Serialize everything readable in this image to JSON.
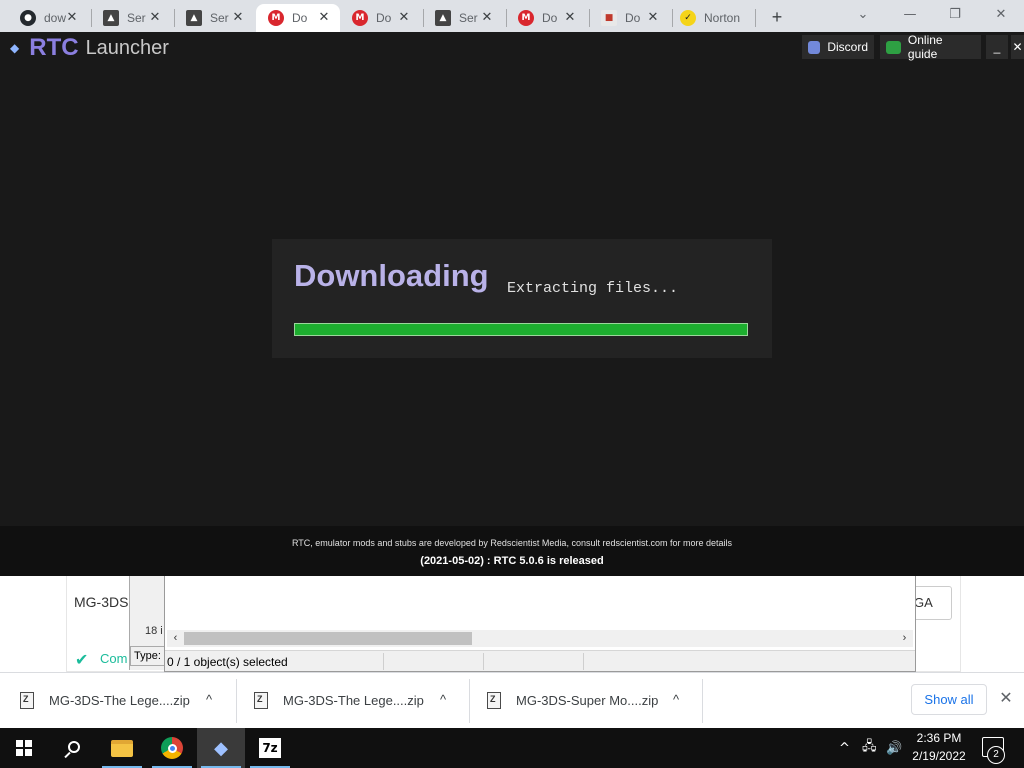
{
  "browser": {
    "tabs": [
      {
        "title": "dow",
        "icon": "github-icon",
        "active": false
      },
      {
        "title": "Ser",
        "icon": "inkscape-icon",
        "active": false
      },
      {
        "title": "Ser",
        "icon": "inkscape-icon",
        "active": false
      },
      {
        "title": "Do",
        "icon": "mega-icon",
        "active": true
      },
      {
        "title": "Do",
        "icon": "mega-icon",
        "active": false
      },
      {
        "title": "Ser",
        "icon": "inkscape-icon",
        "active": false
      },
      {
        "title": "Do",
        "icon": "mega-icon",
        "active": false
      },
      {
        "title": "Do",
        "icon": "box-icon",
        "active": false
      },
      {
        "title": "Norton",
        "icon": "norton-icon",
        "active": false
      }
    ],
    "tab_close_glyph": "✕",
    "new_tab_glyph": "+"
  },
  "launcher": {
    "brand": "RTC",
    "name": "Launcher",
    "discord_label": "Discord",
    "guide_label": "Online guide",
    "minimize_glyph": "_",
    "close_glyph": "✕",
    "download": {
      "heading": "Downloading",
      "status": "Extracting files...",
      "progress": 1.0
    },
    "footer": {
      "credit": "RTC, emulator mods and stubs are developed by Redscientist Media, consult redscientist.com for more details",
      "news": "(2021-05-02) : RTC 5.0.6 is released"
    }
  },
  "background_page": {
    "card_title": "MG-3DS",
    "card_button": "GA",
    "status_check": "✔",
    "status_text": "Com"
  },
  "archive_dialog": {
    "items_count": "18 i",
    "type_label": "Type:",
    "status": "0 / 1 object(s) selected"
  },
  "download_shelf": {
    "items": [
      {
        "name": "MG-3DS-The Lege....zip"
      },
      {
        "name": "MG-3DS-The Lege....zip"
      },
      {
        "name": "MG-3DS-Super Mo....zip"
      }
    ],
    "show_all": "Show all",
    "close_glyph": "✕",
    "chevron_glyph": "^"
  },
  "taskbar": {
    "clock_time": "2:36 PM",
    "clock_date": "2/19/2022",
    "notification_count": "2",
    "sz_label": "7z"
  },
  "colors": {
    "accent_purple": "#8b7fe0",
    "progress_green": "#1dae2f",
    "launcher_bg": "#191919"
  }
}
